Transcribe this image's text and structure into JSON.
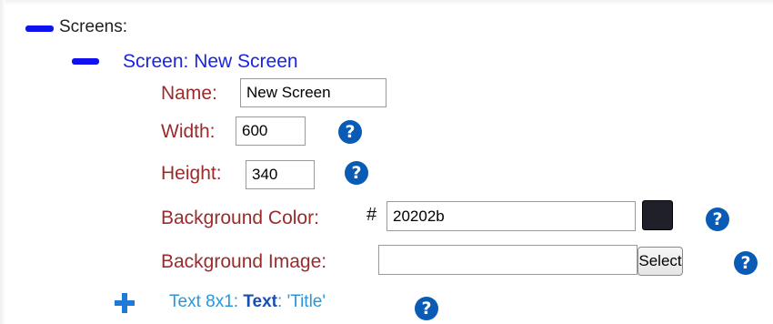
{
  "tree": {
    "root_label": "Screens:",
    "screen": {
      "label": "Screen: New Screen",
      "properties": {
        "name": {
          "label": "Name:",
          "value": "New Screen"
        },
        "width": {
          "label": "Width:",
          "value": "600",
          "help_icon": "question-circle-icon"
        },
        "height": {
          "label": "Height:",
          "value": "340",
          "help_icon": "question-circle-icon"
        },
        "background_color": {
          "label": "Background Color:",
          "prefix": "#",
          "value": "20202b",
          "swatch_color": "#20202b",
          "help_icon": "question-circle-icon"
        },
        "background_image": {
          "label": "Background Image:",
          "value": "",
          "button_label": "Select",
          "help_icon": "question-circle-icon"
        }
      },
      "child": {
        "prefix": "Text 8x1:",
        "type_label": "Text",
        "separator": ":",
        "value": "'Title'",
        "help_icon": "question-circle-icon"
      }
    }
  },
  "icons": {
    "help_glyph": "?",
    "collapse": "minus-icon",
    "expand": "plus-icon"
  },
  "colors": {
    "root_toggle": "#1010f0",
    "screen_label": "#1a25e0",
    "property_label": "#9b2b2b",
    "child_label": "#2896d8",
    "help_icon": "#0a5bb5"
  }
}
